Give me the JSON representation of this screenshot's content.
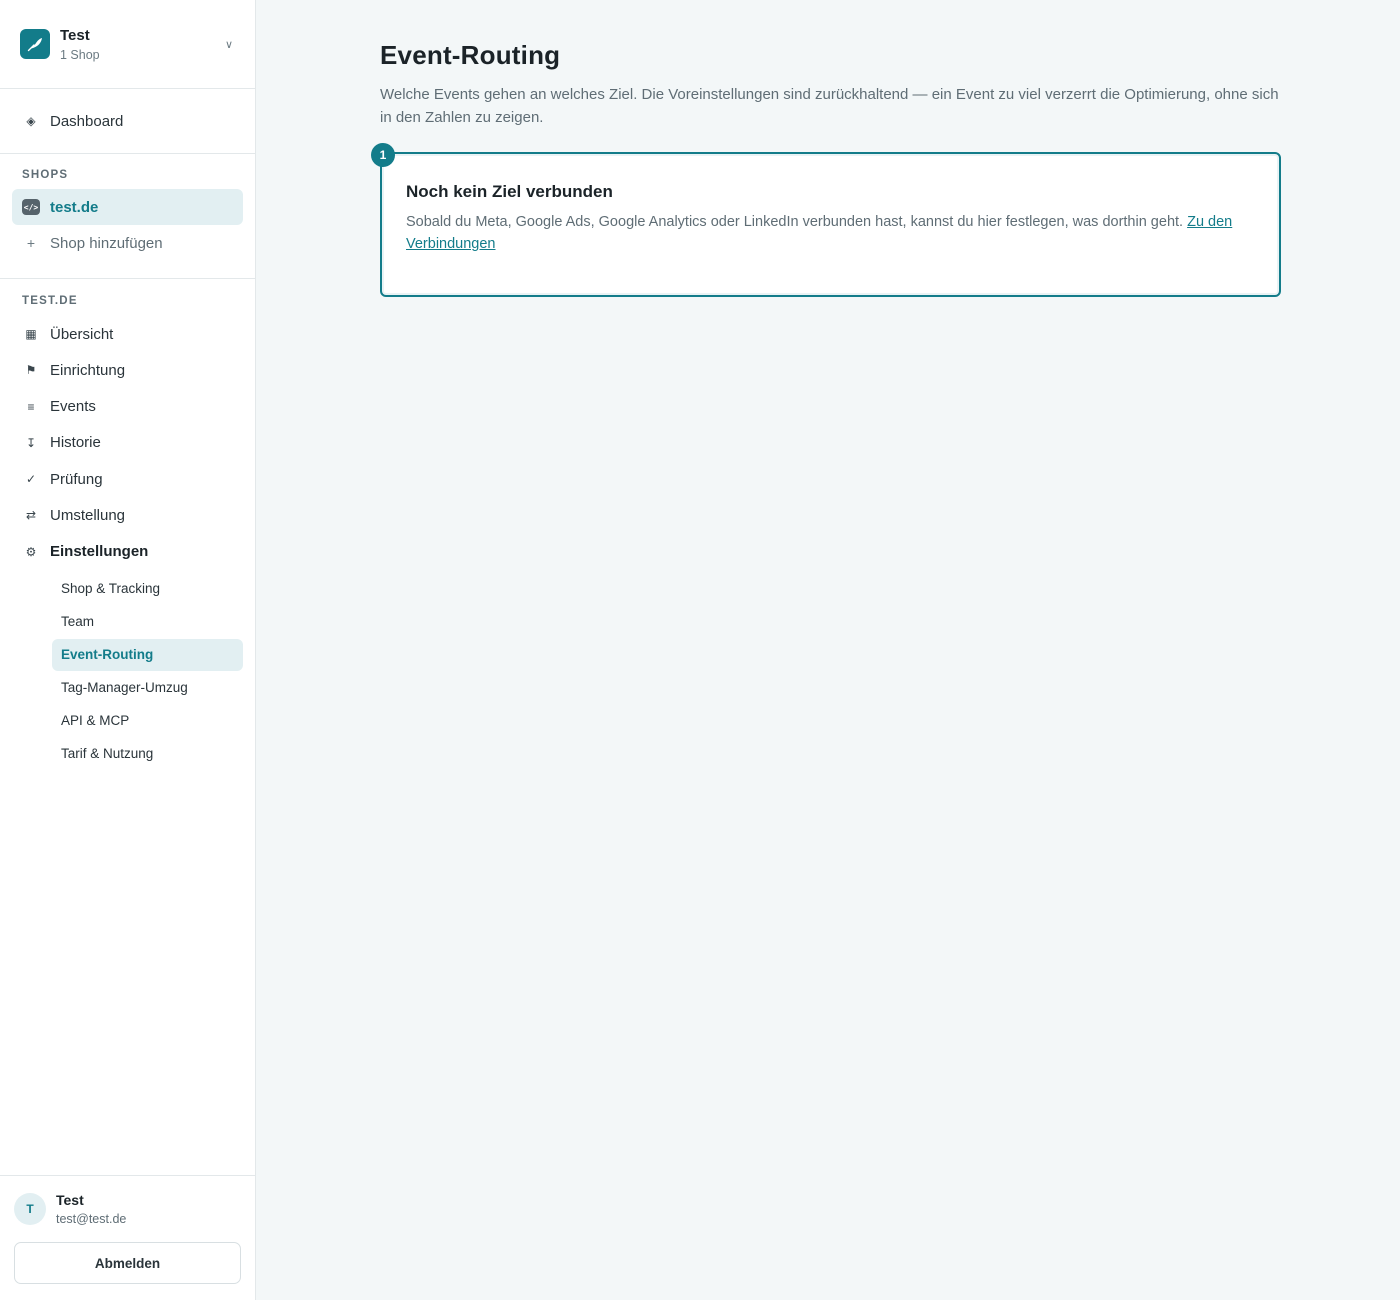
{
  "workspace": {
    "name": "Test",
    "subtitle": "1 Shop"
  },
  "nav": {
    "dashboard": "Dashboard"
  },
  "shops": {
    "label": "SHOPS",
    "items": [
      {
        "label": "test.de",
        "icon": "code-icon"
      }
    ],
    "add_label": "Shop hinzufügen"
  },
  "site": {
    "label": "TEST.DE",
    "items": [
      {
        "label": "Übersicht",
        "icon": "grid-icon"
      },
      {
        "label": "Einrichtung",
        "icon": "flag-icon"
      },
      {
        "label": "Events",
        "icon": "list-icon"
      },
      {
        "label": "Historie",
        "icon": "history-icon"
      },
      {
        "label": "Prüfung",
        "icon": "check-icon"
      },
      {
        "label": "Umstellung",
        "icon": "swap-icon"
      },
      {
        "label": "Einstellungen",
        "icon": "gear-icon"
      }
    ],
    "settings_sub": [
      "Shop & Tracking",
      "Team",
      "Event-Routing",
      "Tag-Manager-Umzug",
      "API & MCP",
      "Tarif & Nutzung"
    ]
  },
  "user": {
    "initial": "T",
    "name": "Test",
    "email": "test@test.de",
    "logout": "Abmelden"
  },
  "page": {
    "title": "Event-Routing",
    "description": "Welche Events gehen an welches Ziel. Die Voreinstellungen sind zurückhaltend — ein Event zu viel verzerrt die Optimierung, ohne sich in den Zahlen zu zeigen."
  },
  "card": {
    "step": "1",
    "title": "Noch kein Ziel verbunden",
    "text": "Sobald du Meta, Google Ads, Google Analytics oder LinkedIn verbunden hast, kannst du hier festlegen, was dorthin geht.",
    "link": "Zu den Verbindungen"
  },
  "colors": {
    "accent": "#137c8a",
    "active_bg": "#e2eff2",
    "page_bg": "#f3f7f8"
  }
}
